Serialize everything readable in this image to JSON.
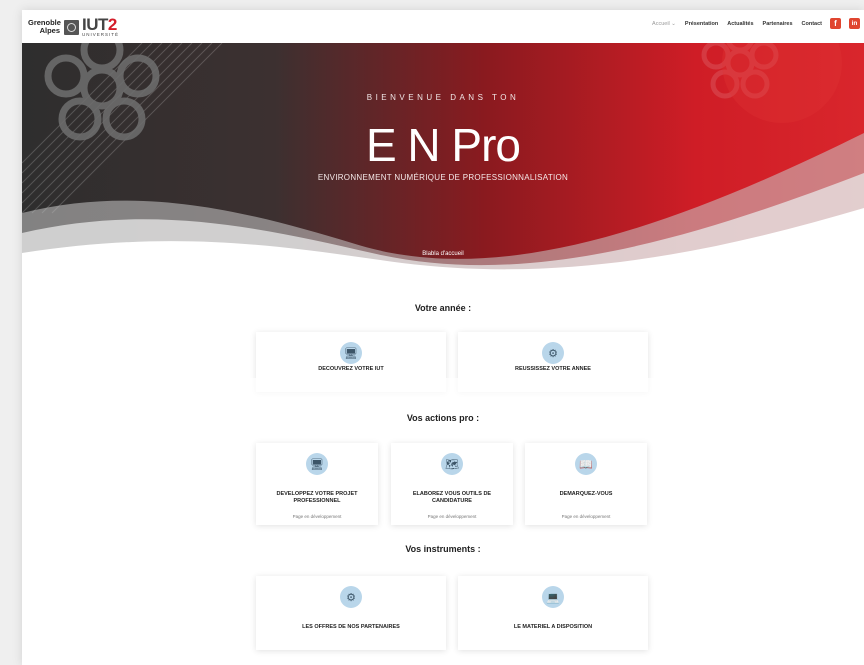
{
  "header": {
    "logo_text_line1": "Grenoble",
    "logo_text_line2": "Alpes",
    "logo_iut": "IUT",
    "logo_two": "2",
    "logo_univ": "UNIVERSITÉ",
    "nav": [
      {
        "label": "Accueil ⌄",
        "active": true
      },
      {
        "label": "Présentation",
        "active": false
      },
      {
        "label": "Actualités",
        "active": false
      },
      {
        "label": "Partenaires",
        "active": false
      },
      {
        "label": "Contact",
        "active": false
      }
    ],
    "social": [
      {
        "icon": "facebook-icon",
        "glyph": "f"
      },
      {
        "icon": "linkedin-icon",
        "glyph": "in"
      }
    ]
  },
  "hero": {
    "subtitle": "BIENVENUE DANS TON",
    "title": "E N Pro",
    "description": "ENVIRONNEMENT NUMÉRIQUE DE PROFESSIONNALISATION",
    "footer": "Blabla d'accueil"
  },
  "sections": {
    "annee": {
      "title": "Votre année :",
      "cards": [
        {
          "label": "DECOUVREZ VOTRE IUT",
          "icon": "computer-icon"
        },
        {
          "label": "REUSSISSEZ VOTRE ANNEE",
          "icon": "brain-icon"
        }
      ]
    },
    "actions": {
      "title": "Vos actions pro :",
      "cards": [
        {
          "label": "DEVELOPPEZ VOTRE PROJET PROFESSIONNEL",
          "note": "Page en développement",
          "icon": "monitor-icon"
        },
        {
          "label": "ELABOREZ VOUS OUTILS DE CANDIDATURE",
          "note": "Page en développement",
          "icon": "map-icon"
        },
        {
          "label": "DEMARQUEZ-VOUS",
          "note": "Page en développement",
          "icon": "book-icon"
        }
      ]
    },
    "instruments": {
      "title": "Vos instruments :",
      "cards": [
        {
          "label": "LES OFFRES DE NOS PARTENAIRES",
          "icon": "gear-hand-icon"
        },
        {
          "label": "LE MATERIEL A DISPOSITION",
          "icon": "laptop-icon"
        }
      ]
    }
  },
  "colors": {
    "accent": "#d41e2a",
    "icon_circle": "#b9d6ea"
  }
}
